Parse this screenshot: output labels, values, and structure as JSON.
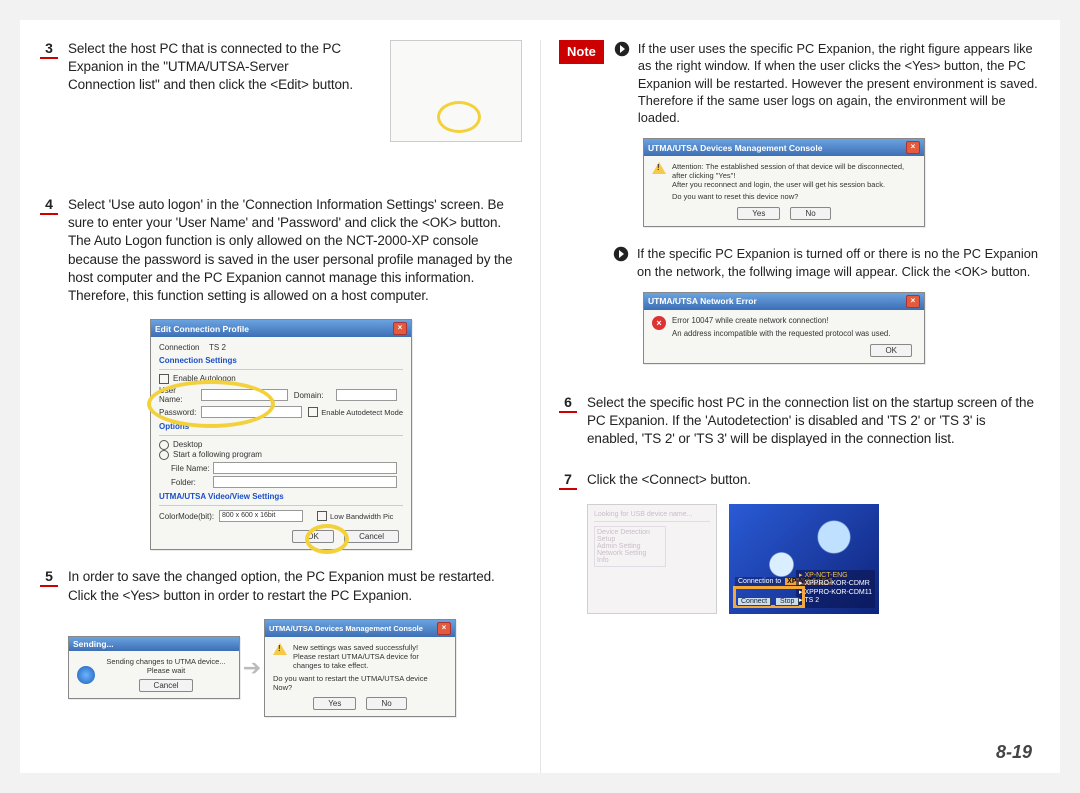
{
  "page_number": "8-19",
  "left": {
    "step3": {
      "num": "3",
      "text": "Select the host PC that is connected to the PC Expanion in the \"UTMA/UTSA-Server Connection list\" and then click the <Edit> button."
    },
    "step4": {
      "num": "4",
      "text": "Select 'Use auto logon' in the 'Connection Information Settings' screen. Be sure to enter your 'User Name' and 'Password' and click the <OK> button. The Auto Logon function is only allowed on the NCT-2000-XP console because the password is saved in the user personal profile managed by the host computer and the PC Expanion cannot manage this information. Therefore, this function setting is allowed on a host computer."
    },
    "profile_win": {
      "title": "Edit Connection Profile",
      "conn_label": "Connection",
      "conn_value": "TS 2",
      "group1": "Connection Settings",
      "enable": "Enable Autologon",
      "user_label": "User Name:",
      "pass_label": "Password:",
      "domain_label": "Domain:",
      "autodetect": "Enable Autodetect Mode",
      "group2": "Options",
      "opt_desktop": "Desktop",
      "opt_start": "Start a following program",
      "fname": "File Name:",
      "folder": "Folder:",
      "group3": "UTMA/UTSA Video/View Settings",
      "colormode": "ColorMode(bit):",
      "colormode_val": "800 x 600 x 16bit",
      "lowband": "Low Bandwidth Pic",
      "ok": "OK",
      "cancel": "Cancel"
    },
    "step5": {
      "num": "5",
      "text": "In order to save the changed option, the PC Expanion must be restarted. Click the <Yes> button in order to restart the PC Expanion."
    },
    "sending_win": {
      "title": "Sending...",
      "line1": "Sending changes to UTMA device...",
      "line2": "Please wait",
      "cancel": "Cancel"
    },
    "restart_win": {
      "title": "UTMA/UTSA Devices Management Console",
      "line1": "New settings was saved successfully!",
      "line2": "Please restart UTMA/UTSA device for changes to take effect.",
      "line3": "Do you want to restart the UTMA/UTSA device Now?",
      "yes": "Yes",
      "no": "No"
    }
  },
  "right": {
    "note_label": "Note",
    "note1": "If the user uses the specific PC Expanion, the right figure appears like as the right window. If when the user clicks the <Yes> button, the PC Expanion will be restarted. However the present environment is saved. Therefore if the same user logs on again, the environment will be loaded.",
    "reset_win": {
      "title": "UTMA/UTSA Devices Management Console",
      "l1": "Attention: The established session of that device will be disconnected, after clicking \"Yes\"!",
      "l2": "After you reconnect and login, the user will get his session back.",
      "l3": "Do you want to reset this device now?",
      "yes": "Yes",
      "no": "No"
    },
    "note2": "If the specific PC Expanion is turned off or there is no the PC Expanion on the network, the follwing image will appear. Click the <OK> button.",
    "err_win": {
      "title": "UTMA/UTSA Network Error",
      "l1": "Error 10047 while create network connection!",
      "l2": "An address incompatible with the requested protocol was used.",
      "ok": "OK"
    },
    "step6": {
      "num": "6",
      "text": "Select the specific host PC in the connection list on the startup screen of the PC Expanion. If the 'Autodetection' is disabled and 'TS 2' or 'TS 3' is enabled, 'TS 2' or 'TS 3' will be displayed in the connection list."
    },
    "step7": {
      "num": "7",
      "text": "Click the <Connect> button."
    },
    "startup": {
      "header": "Looking for USB device name...",
      "items": [
        "Device Detection",
        "Setup",
        "Admin Setting",
        "Network Setting",
        "Info"
      ],
      "conn_to": "Connection to",
      "host": "XP-NCT-ENG",
      "rows": [
        "XP-NCT-ENG",
        "XPPRO-KOR-CDMR",
        "XPPRO-KOR-CDM11",
        "TS 2"
      ],
      "connect": "Connect",
      "stop": "Stop"
    }
  }
}
